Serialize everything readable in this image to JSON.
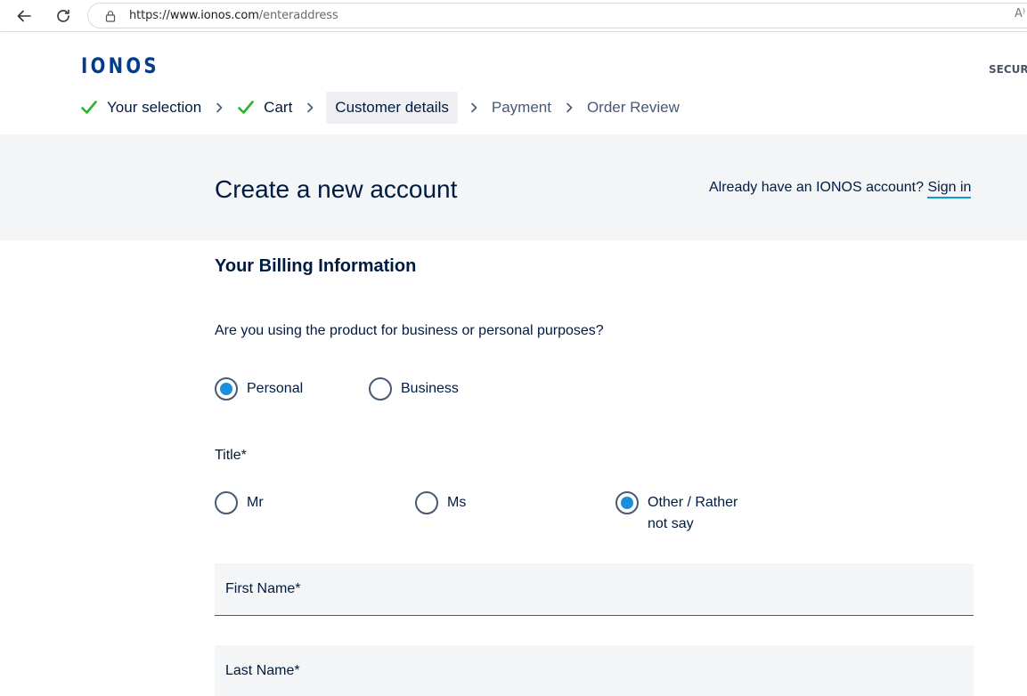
{
  "browser": {
    "url_scheme": "https://",
    "url_host": "www.ionos.com",
    "url_path": "/enteraddress",
    "read_aloud": "A⁾"
  },
  "header": {
    "logo": "IONOS",
    "secure": "SECURE",
    "steps": [
      {
        "label": "Your selection",
        "done": true
      },
      {
        "label": "Cart",
        "done": true
      },
      {
        "label": "Customer details",
        "current": true
      },
      {
        "label": "Payment"
      },
      {
        "label": "Order Review"
      }
    ]
  },
  "hero": {
    "title": "Create a new account",
    "signin_prompt": "Already have an IONOS account?",
    "signin_link": "Sign in"
  },
  "form": {
    "section_title": "Your Billing Information",
    "purpose_question": "Are you using the product for business or personal purposes?",
    "purpose_options": [
      {
        "label": "Personal",
        "selected": true
      },
      {
        "label": "Business",
        "selected": false
      }
    ],
    "title_label": "Title*",
    "title_options": [
      {
        "label": "Mr",
        "selected": false
      },
      {
        "label": "Ms",
        "selected": false
      },
      {
        "label": "Other / Rather not say",
        "selected": true
      }
    ],
    "first_name_placeholder": "First Name*",
    "last_name_placeholder": "Last Name*"
  },
  "colors": {
    "brand": "#003d8f",
    "text": "#001b41",
    "radio_selected": "#1b8ee0",
    "check_green": "#2db12d",
    "link_underline": "#0b9dcc"
  }
}
